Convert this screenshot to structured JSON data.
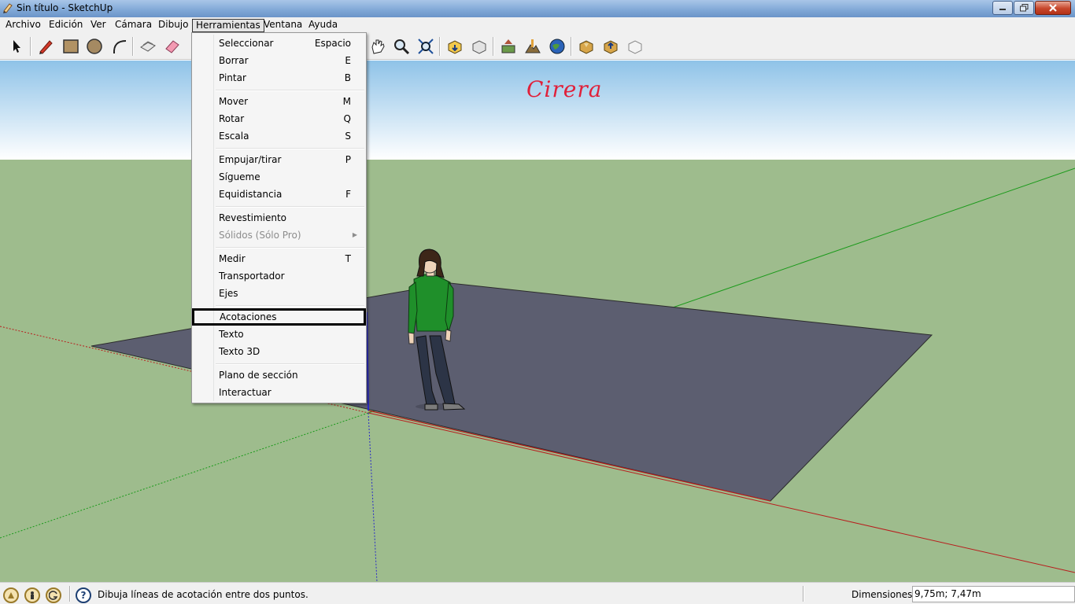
{
  "window": {
    "title": "Sin título - SketchUp"
  },
  "menubar": {
    "items": [
      "Archivo",
      "Edición",
      "Ver",
      "Cámara",
      "Dibujo",
      "Herramientas",
      "Ventana",
      "Ayuda"
    ],
    "active": "Herramientas"
  },
  "toolbar": {
    "icons": [
      "select-icon",
      "pencil-icon",
      "rectangle-icon",
      "circle-icon",
      "arc-icon",
      "make-component-icon",
      "eraser-icon",
      "tape-measure-icon",
      "pan-icon",
      "zoom-icon",
      "zoom-extents-icon",
      "get-models-icon",
      "share-model-icon",
      "add-location-icon",
      "toggle-terrain-icon",
      "google-earth-icon",
      "get-models-2-icon",
      "share-component-icon",
      "preview-icon"
    ]
  },
  "viewport": {
    "model_title": "Cirera",
    "sky_color": "#ffffff",
    "ground_color": "#9ebc8d",
    "face_color": "#5c5e70"
  },
  "tools_menu": {
    "items": [
      {
        "label": "Seleccionar",
        "shortcut": "Espacio"
      },
      {
        "label": "Borrar",
        "shortcut": "E"
      },
      {
        "label": "Pintar",
        "shortcut": "B"
      },
      {
        "label": "Mover",
        "shortcut": "M"
      },
      {
        "label": "Rotar",
        "shortcut": "Q"
      },
      {
        "label": "Escala",
        "shortcut": "S"
      },
      {
        "label": "Empujar/tirar",
        "shortcut": "P"
      },
      {
        "label": "Sígueme",
        "shortcut": ""
      },
      {
        "label": "Equidistancia",
        "shortcut": "F"
      },
      {
        "label": "Revestimiento",
        "shortcut": ""
      },
      {
        "label": "Sólidos (Sólo Pro)",
        "shortcut": "",
        "disabled": true,
        "submenu": true
      },
      {
        "label": "Medir",
        "shortcut": "T"
      },
      {
        "label": "Transportador",
        "shortcut": ""
      },
      {
        "label": "Ejes",
        "shortcut": ""
      },
      {
        "label": "Acotaciones",
        "shortcut": "",
        "highlighted": true
      },
      {
        "label": "Texto",
        "shortcut": ""
      },
      {
        "label": "Texto 3D",
        "shortcut": ""
      },
      {
        "label": "Plano de sección",
        "shortcut": ""
      },
      {
        "label": "Interactuar",
        "shortcut": ""
      }
    ]
  },
  "statusbar": {
    "message": "Dibuja líneas de acotación entre dos puntos.",
    "dimensions_label": "Dimensiones",
    "dimensions_value": "9,75m; 7,47m"
  }
}
